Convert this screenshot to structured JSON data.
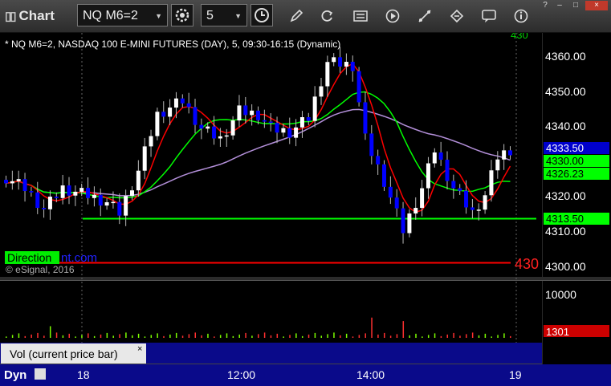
{
  "titlebar": {
    "title": "Chart",
    "symbol": "NQ M6=2",
    "interval": "5",
    "window_controls": [
      "?",
      "–",
      "□",
      "×"
    ]
  },
  "chart": {
    "header": "* NQ M6=2, NASDAQ 100 E-MINI FUTURES (DAY), 5, 09:30-16:15 (Dynamic)",
    "copyright": "© eSignal, 2016",
    "watermark_label": "Direction",
    "watermark_text": "nt.com",
    "corner_label": "430",
    "top_right_label": "430",
    "price_axis": [
      "4360.00",
      "4350.00",
      "4340.00",
      "4320.00",
      "4310.00",
      "4300.00"
    ],
    "price_tags": [
      {
        "text": "4333.50",
        "bg": "#0000cc",
        "fg": "#ffffff"
      },
      {
        "text": "4330.00",
        "bg": "#00ff00",
        "fg": "#000000"
      },
      {
        "text": "4326.23",
        "bg": "#00ff00",
        "fg": "#000000"
      },
      {
        "text": "4313.50",
        "bg": "#00ff00",
        "fg": "#000000"
      }
    ],
    "volume_axis": "10000",
    "volume_tag": "1301",
    "volume_panel_label": "Vol (current price bar)",
    "close_glyph": "×",
    "footer_label": "Dyn",
    "time_axis": [
      "18",
      "12:00",
      "14:00",
      "19"
    ],
    "colors": {
      "up_candle": "#ffffff",
      "down_candle": "#0000ff",
      "ma_red": "#ff0000",
      "ma_green": "#00ff00",
      "ma_purple": "#b38fd9",
      "level_green": "#00ff00",
      "level_red": "#ff0000"
    }
  }
}
